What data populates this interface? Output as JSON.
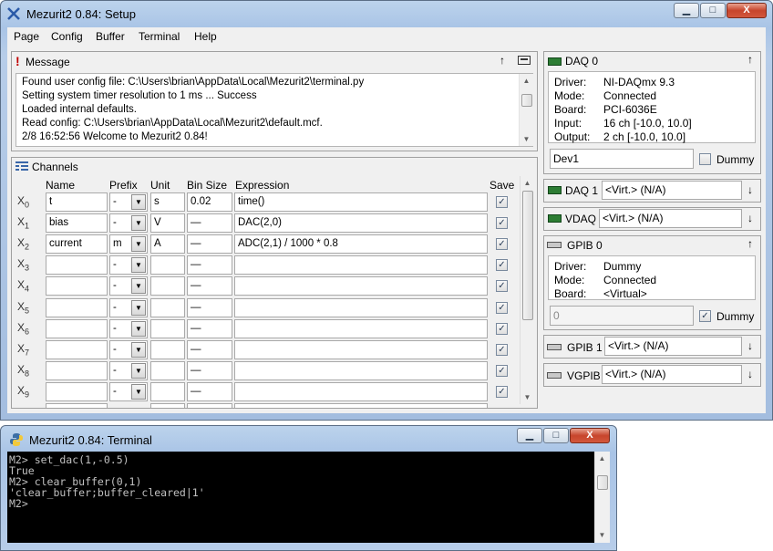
{
  "main_window": {
    "title": "Mezurit2 0.84: Setup",
    "controls": {
      "minimize": "▁",
      "maximize": "□",
      "close": "X"
    }
  },
  "menu": [
    {
      "label": "Page"
    },
    {
      "label": "Config"
    },
    {
      "label": "Buffer"
    },
    {
      "label": "Terminal"
    },
    {
      "label": "Help"
    }
  ],
  "message_panel": {
    "title": "Message",
    "lines": [
      "Found user config file: C:\\Users\\brian\\AppData\\Local\\Mezurit2\\terminal.py",
      "Setting system timer resolution to 1 ms ... Success",
      "Loaded internal defaults.",
      "Read config: C:\\Users\\brian\\AppData\\Local\\Mezurit2\\default.mcf.",
      "2/8 16:52:56  Welcome to Mezurit2 0.84!"
    ]
  },
  "channels_panel": {
    "title": "Channels",
    "headers": {
      "name": "Name",
      "prefix": "Prefix",
      "unit": "Unit",
      "bin_size": "Bin Size",
      "expression": "Expression",
      "save": "Save"
    },
    "rows": [
      {
        "x": "X",
        "sub": "0",
        "name": "t",
        "prefix": "-",
        "unit": "s",
        "bin": "0.02",
        "expr": "time()",
        "save": true
      },
      {
        "x": "X",
        "sub": "1",
        "name": "bias",
        "prefix": "-",
        "unit": "V",
        "bin": "—",
        "expr": "DAC(2,0)",
        "save": true
      },
      {
        "x": "X",
        "sub": "2",
        "name": "current",
        "prefix": "m",
        "unit": "A",
        "bin": "—",
        "expr": "ADC(2,1) / 1000 * 0.8",
        "save": true
      },
      {
        "x": "X",
        "sub": "3",
        "name": "",
        "prefix": "-",
        "unit": "",
        "bin": "—",
        "expr": "",
        "save": true
      },
      {
        "x": "X",
        "sub": "4",
        "name": "",
        "prefix": "-",
        "unit": "",
        "bin": "—",
        "expr": "",
        "save": true
      },
      {
        "x": "X",
        "sub": "5",
        "name": "",
        "prefix": "-",
        "unit": "",
        "bin": "—",
        "expr": "",
        "save": true
      },
      {
        "x": "X",
        "sub": "6",
        "name": "",
        "prefix": "-",
        "unit": "",
        "bin": "—",
        "expr": "",
        "save": true
      },
      {
        "x": "X",
        "sub": "7",
        "name": "",
        "prefix": "-",
        "unit": "",
        "bin": "—",
        "expr": "",
        "save": true
      },
      {
        "x": "X",
        "sub": "8",
        "name": "",
        "prefix": "-",
        "unit": "",
        "bin": "—",
        "expr": "",
        "save": true
      },
      {
        "x": "X",
        "sub": "9",
        "name": "",
        "prefix": "-",
        "unit": "",
        "bin": "—",
        "expr": "",
        "save": true
      }
    ]
  },
  "daq0": {
    "title": "DAQ 0",
    "info": [
      {
        "label": "Driver:",
        "value": "NI-DAQmx 9.3"
      },
      {
        "label": "Mode:",
        "value": "Connected"
      },
      {
        "label": "Board:",
        "value": "PCI-6036E"
      },
      {
        "label": "Input:",
        "value": "16 ch [-10.0, 10.0]"
      },
      {
        "label": "Output:",
        "value": "2 ch [-10.0, 10.0]"
      }
    ],
    "device": "Dev1",
    "dummy_label": "Dummy"
  },
  "daq1": {
    "title": "DAQ 1",
    "value": "<Virt.> (N/A)"
  },
  "vdaq": {
    "title": "VDAQ",
    "value": "<Virt.> (N/A)"
  },
  "gpib0": {
    "title": "GPIB 0",
    "info": [
      {
        "label": "Driver:",
        "value": "Dummy"
      },
      {
        "label": "Mode:",
        "value": "Connected"
      },
      {
        "label": "Board:",
        "value": "<Virtual>"
      }
    ],
    "device": "0",
    "dummy_label": "Dummy"
  },
  "gpib1": {
    "title": "GPIB 1",
    "value": "<Virt.> (N/A)"
  },
  "vgpib": {
    "title": "VGPIB",
    "value": "<Virt.> (N/A)"
  },
  "terminal_window": {
    "title": "Mezurit2 0.84: Terminal",
    "lines": [
      "M2> set_dac(1,-0.5)",
      "True",
      "M2> clear_buffer(0,1)",
      "'clear_buffer;buffer_cleared|1'",
      "M2>"
    ]
  },
  "colors": {
    "accent": "#2d7d34",
    "close": "#c7452c"
  }
}
